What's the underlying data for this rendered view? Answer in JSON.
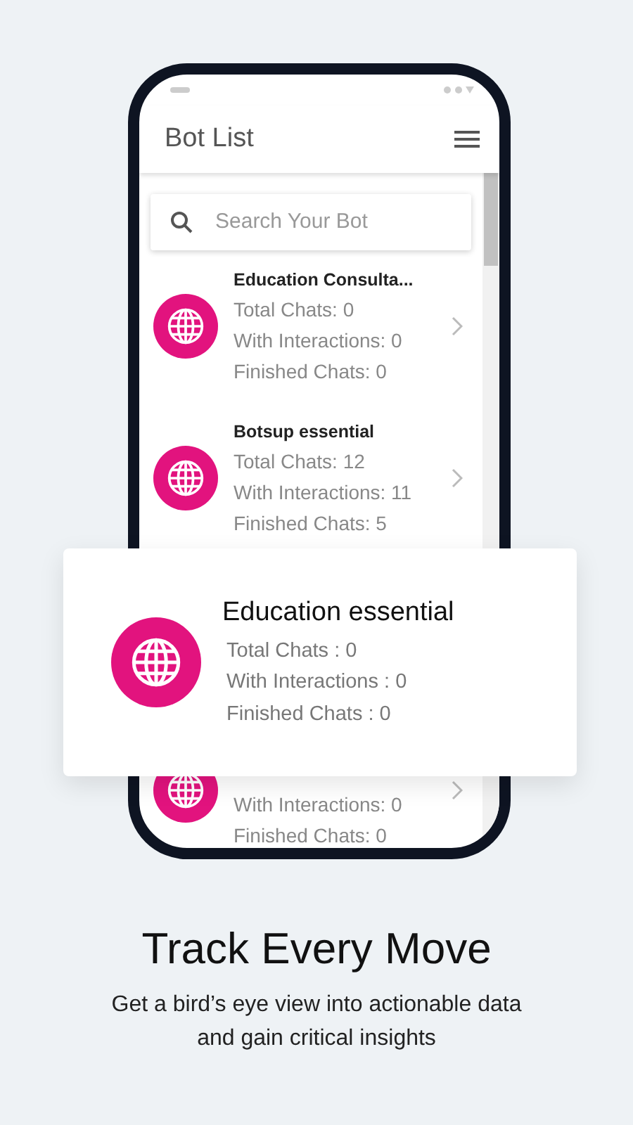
{
  "app_bar": {
    "title": "Bot List"
  },
  "search": {
    "placeholder": "Search Your Bot"
  },
  "bots": [
    {
      "name": "Education Consulta...",
      "total_chats": "Total Chats: 0",
      "with_interactions": "With Interactions: 0",
      "finished_chats": "Finished Chats: 0"
    },
    {
      "name": "Botsup essential",
      "total_chats": "Total Chats: 12",
      "with_interactions": "With Interactions: 11",
      "finished_chats": "Finished Chats: 5"
    },
    {
      "hidden_above": true,
      "with_interactions": "With Interactions: 0",
      "finished_chats": "Finished Chats: 0"
    }
  ],
  "highlight_card": {
    "name": "Education essential",
    "total_chats": "Total Chats : 0",
    "with_interactions": "With Interactions : 0",
    "finished_chats": "Finished Chats : 0"
  },
  "headline": "Track Every Move",
  "tagline": "Get a bird’s eye view into actionable data and gain critical insights"
}
